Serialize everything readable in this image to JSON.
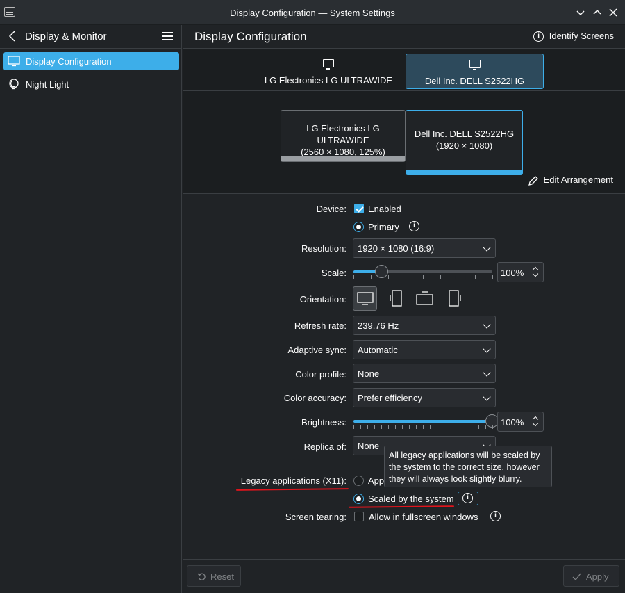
{
  "window": {
    "title": "Display Configuration — System Settings"
  },
  "sidebar": {
    "title": "Display & Monitor",
    "items": [
      {
        "label": "Display Configuration",
        "icon": "monitor-icon"
      },
      {
        "label": "Night Light",
        "icon": "night-light-icon"
      }
    ]
  },
  "header": {
    "title": "Display Configuration",
    "identify_label": "Identify Screens"
  },
  "tabs": [
    {
      "label": "LG Electronics LG ULTRAWIDE"
    },
    {
      "label": "Dell Inc. DELL S2522HG"
    }
  ],
  "arrangement": {
    "screens": [
      {
        "name": "LG Electronics LG ULTRAWIDE",
        "detail": "(2560 × 1080, 125%)"
      },
      {
        "name": "Dell Inc. DELL S2522HG",
        "detail": "(1920 × 1080)"
      }
    ],
    "edit_label": "Edit Arrangement"
  },
  "form": {
    "device_label": "Device:",
    "enabled_label": "Enabled",
    "primary_label": "Primary",
    "resolution_label": "Resolution:",
    "resolution_value": "1920 × 1080 (16:9)",
    "scale_label": "Scale:",
    "scale_value": "100%",
    "scale_level": 0.2,
    "orientation_label": "Orientation:",
    "refresh_label": "Refresh rate:",
    "refresh_value": "239.76 Hz",
    "adaptive_label": "Adaptive sync:",
    "adaptive_value": "Automatic",
    "color_profile_label": "Color profile:",
    "color_profile_value": "None",
    "color_accuracy_label": "Color accuracy:",
    "color_accuracy_value": "Prefer efficiency",
    "brightness_label": "Brightness:",
    "brightness_value": "100%",
    "brightness_level": 1.0,
    "replica_label": "Replica of:",
    "replica_value": "None",
    "legacy_label": "Legacy applications (X11):",
    "legacy_option1": "Apply scaling themselves",
    "legacy_option1_visible": "App",
    "legacy_option2": "Scaled by the system",
    "tearing_label": "Screen tearing:",
    "tearing_option": "Allow in fullscreen windows"
  },
  "tooltip": {
    "line1": "All legacy applications will be scaled by",
    "line2": "the system to the correct size, however",
    "line3": "they will always look slightly blurry."
  },
  "footer": {
    "reset_label": "Reset",
    "apply_label": "Apply"
  },
  "colors": {
    "accent": "#3daee9",
    "background": "#202326",
    "annotation": "#e0141c"
  }
}
